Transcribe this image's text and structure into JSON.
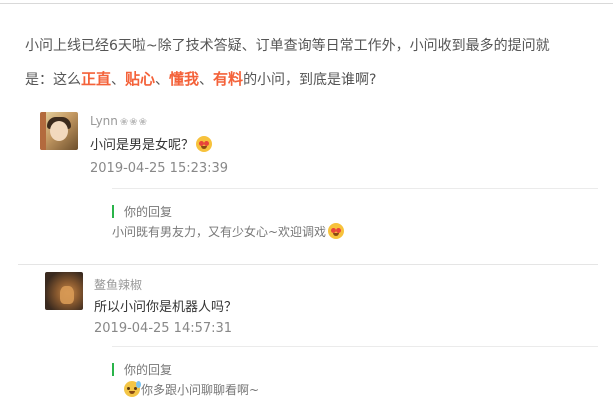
{
  "intro": {
    "line1": "小问上线已经6天啦~除了技术答疑、订单查询等日常工作外，小问收到最多的提问就",
    "line2_prefix": "是：这么",
    "kw1": "正直",
    "sep1": "、",
    "kw2": "贴心",
    "sep2": "、",
    "kw3": "懂我",
    "sep3": "、",
    "kw4": "有料",
    "line2_suffix": "的小问，到底是谁啊?"
  },
  "comments": [
    {
      "name": "Lynn",
      "name_suffix": "❀❀❀",
      "text": "小问是男是女呢？",
      "emoji": "heart-eyes-emoji",
      "date": "2019-04-25 15:23:39",
      "reply_label": "你的回复",
      "reply_text": "小问既有男友力，又有少女心~欢迎调戏",
      "reply_emoji": "heart-eyes-emoji"
    },
    {
      "name": "鳌鱼辣椒",
      "text": "所以小问你是机器人吗？",
      "date": "2019-04-25 14:57:31",
      "reply_label": "你的回复",
      "reply_emoji": "sweat-smile-emoji",
      "reply_text": "你多跟小问聊聊看啊~"
    }
  ],
  "colors": {
    "highlight": "#f4623a",
    "reply_bar": "#2ab44a"
  }
}
